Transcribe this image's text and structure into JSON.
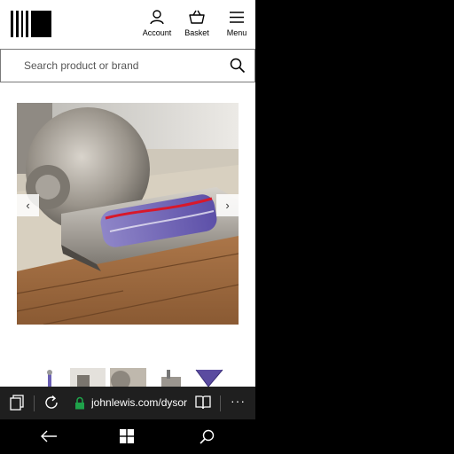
{
  "header": {
    "account_label": "Account",
    "basket_label": "Basket",
    "menu_label": "Menu"
  },
  "search": {
    "placeholder": "Search product or brand"
  },
  "gallery": {
    "prev": "‹",
    "next": "›"
  },
  "browser": {
    "url": "johnlewis.com/dysor",
    "more": "···"
  },
  "colors": {
    "page_bg": "#ffffff",
    "browser_bar": "#1f1f1f",
    "lock_green": "#1fa24a",
    "system_bar": "#000000"
  },
  "icons": [
    "logo",
    "account-icon",
    "basket-icon",
    "menu-icon",
    "search-icon",
    "tabs-icon",
    "refresh-icon",
    "lock-icon",
    "reading-view-icon",
    "more-icon",
    "back-icon",
    "windows-icon",
    "system-search-icon"
  ]
}
